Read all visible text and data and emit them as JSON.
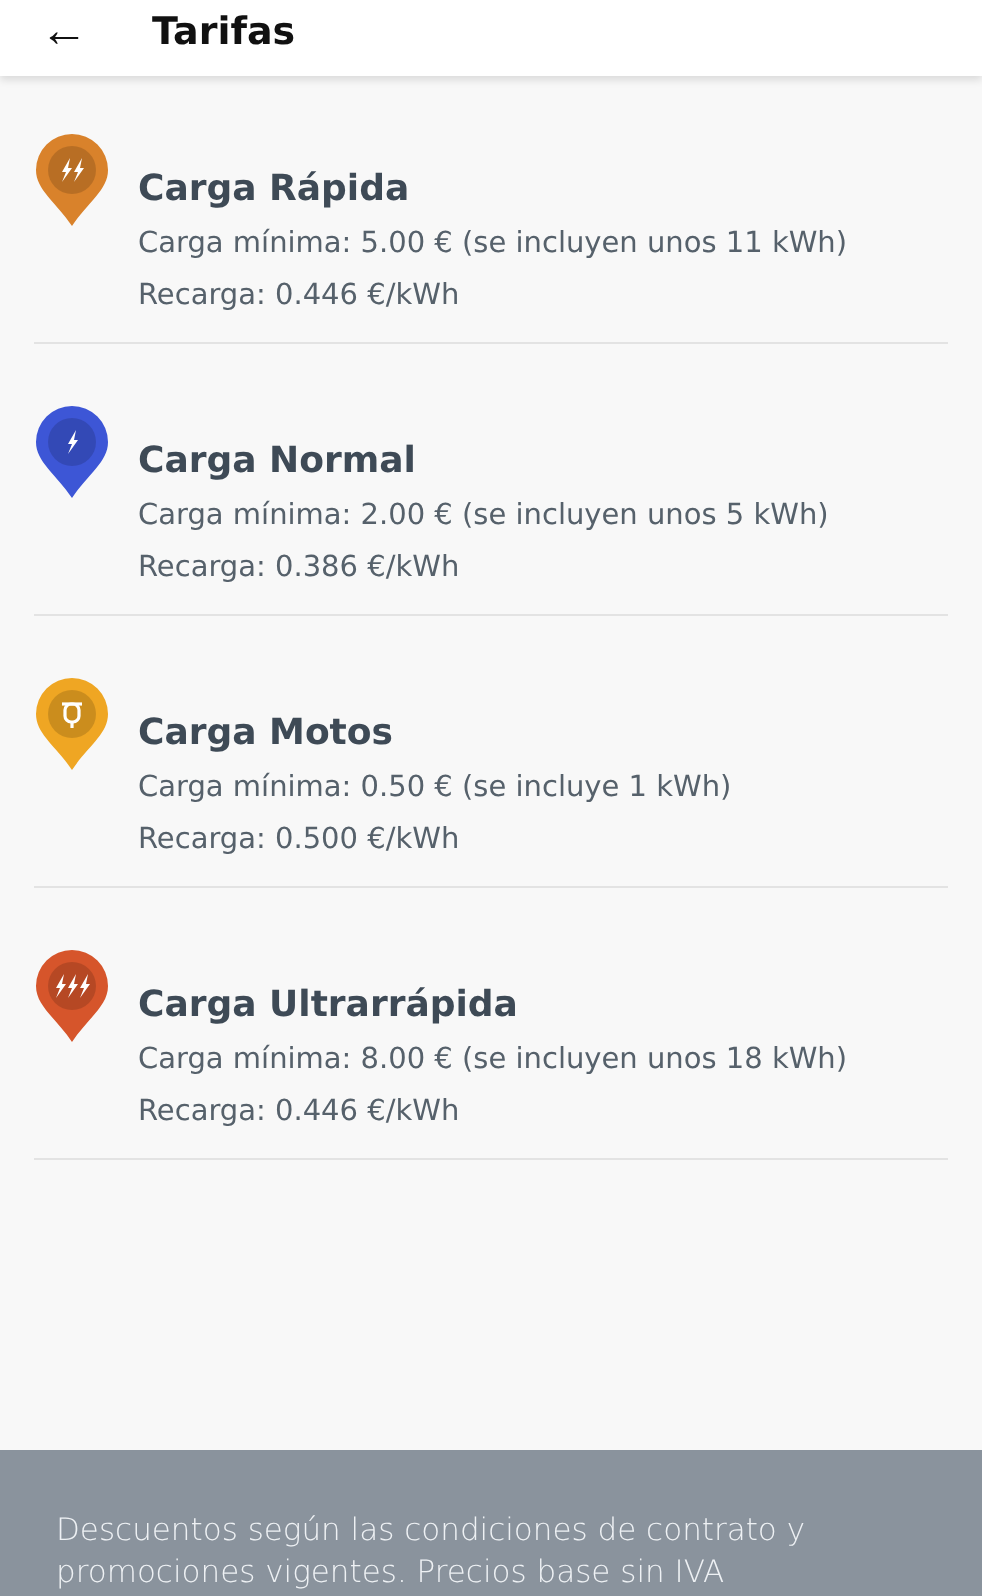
{
  "header": {
    "back_icon": "←",
    "title": "Tarifas"
  },
  "tariffs": [
    {
      "kind": "bolt2",
      "color": "#d9822b",
      "name": "Carga Rápida",
      "minimum": "Carga mínima: 5.00 € (se incluyen unos 11 kWh)",
      "recharge": "Recarga: 0.446 €/kWh"
    },
    {
      "kind": "bolt1",
      "color": "#3d56d6",
      "name": "Carga Normal",
      "minimum": "Carga mínima: 2.00 € (se incluyen unos 5 kWh)",
      "recharge": "Recarga: 0.386 €/kWh"
    },
    {
      "kind": "moto",
      "color": "#efa623",
      "name": "Carga Motos",
      "minimum": "Carga mínima: 0.50 € (se incluye 1 kWh)",
      "recharge": "Recarga: 0.500 €/kWh"
    },
    {
      "kind": "bolt3",
      "color": "#d6552b",
      "name": "Carga Ultrarrápida",
      "minimum": "Carga mínima: 8.00 € (se incluyen unos 18 kWh)",
      "recharge": "Recarga: 0.446 €/kWh"
    }
  ],
  "footer": {
    "note": "Descuentos según las condiciones de contrato y promociones vigentes. Precios base sin IVA"
  }
}
